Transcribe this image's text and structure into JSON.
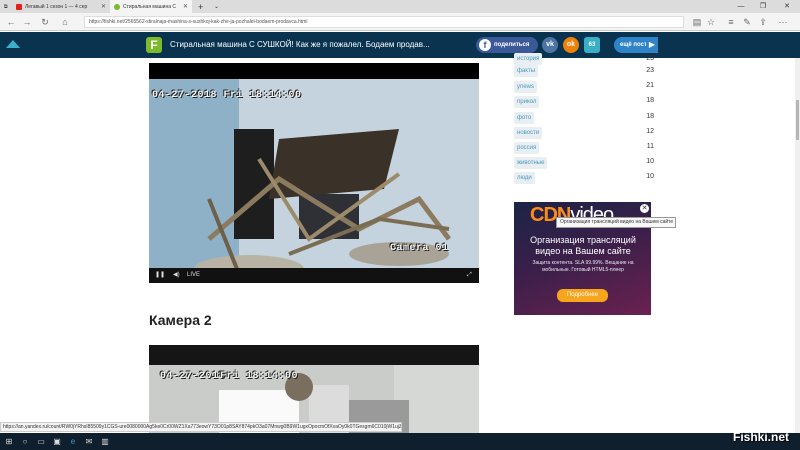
{
  "browser": {
    "tabs": [
      {
        "title": "Легавый 1 сезон 1 — 4 сер",
        "active": false,
        "icon": "youtube-icon"
      },
      {
        "title": "Стиральная машина С",
        "active": true,
        "icon": "fishki-icon"
      }
    ],
    "new_tab": "+",
    "url": "https://fishki.net/2565562-stiralnaja-mashina-s-sushkoj-kak-zhe-ja-pozhalel-bodaem-prodavca.html",
    "status_url": "https://an.yandex.ru/count/RW0jYRhsI85509y1CGS-ure0080000Ag5ke0Cr00WZ1Xa773eowY73O01p8SAY874pkO3a07Mnwg0B9W1ugxOpocmOfXvaOy0k0TGesgm6C010jW1ujZp4kl"
  },
  "header": {
    "logo_letter": "F",
    "title": "Стиральная машина С СУШКОЙ! Как же я пожалел. Бодаем продав...",
    "share_label": "поделиться",
    "vk_label": "vk",
    "ok_label": "ok",
    "counter_label": "63",
    "next_post_label": "ещё пост"
  },
  "article": {
    "cam1_stamp": "04-27-2018 Fri 18:14:00",
    "cam1_label": "Camera 01",
    "live_label": "LIVE",
    "heading2": "Камера 2",
    "cam2_date": "04-27-2018",
    "cam2_time": "Fri 18:14:00"
  },
  "tags": [
    {
      "label": "история",
      "count": "23"
    },
    {
      "label": "факты",
      "count": "23"
    },
    {
      "label": "ynews",
      "count": "21"
    },
    {
      "label": "прикол",
      "count": "18"
    },
    {
      "label": "фото",
      "count": "18"
    },
    {
      "label": "новости",
      "count": "12"
    },
    {
      "label": "россия",
      "count": "11"
    },
    {
      "label": "животные",
      "count": "10"
    },
    {
      "label": "люди",
      "count": "10"
    }
  ],
  "ad": {
    "logo_cdn": "CDN",
    "logo_video": "video",
    "tooltip": "Организация трансляций видео на Вашем сайте",
    "headline": "Организация трансляций видео на Вашем сайте",
    "body": "Защита контента. SLA 99.99%. Вещание на мобильные. Готовый HTML5-плеер",
    "button": "Подробнее"
  },
  "watermark": "Fishki.net",
  "colors": {
    "header_bg": "#0a3350",
    "accent": "#7dbb2c",
    "tag_text": "#4a9ac0"
  }
}
